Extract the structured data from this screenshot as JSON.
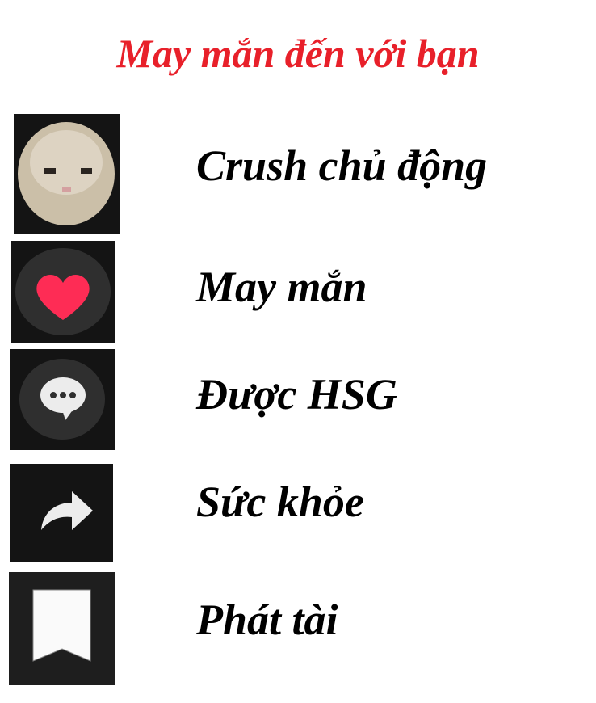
{
  "title": "May mắn đến với bạn",
  "items": [
    {
      "icon": "cat-avatar-icon",
      "label": "Crush chủ động"
    },
    {
      "icon": "heart-icon",
      "label": "May mắn"
    },
    {
      "icon": "comment-icon",
      "label": "Được HSG"
    },
    {
      "icon": "share-icon",
      "label": "Sức khỏe"
    },
    {
      "icon": "bookmark-icon",
      "label": "Phát tài"
    }
  ],
  "colors": {
    "title": "#e8202a",
    "heart": "#fe2c55",
    "tile": "#141414"
  }
}
